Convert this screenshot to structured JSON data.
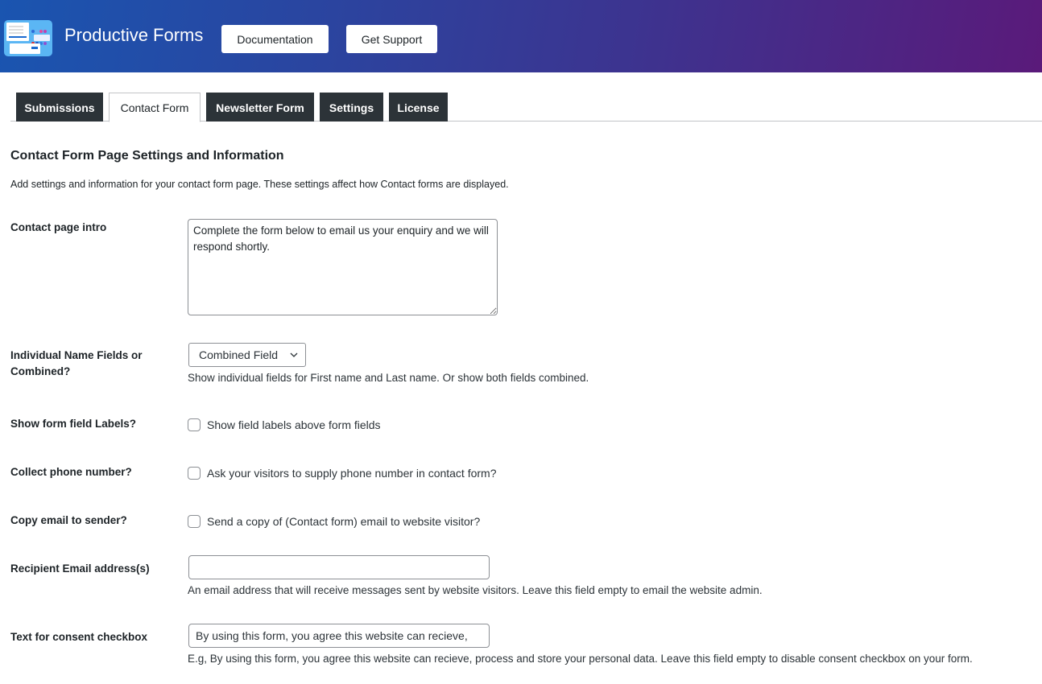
{
  "header": {
    "app_title": "Productive Forms",
    "buttons": {
      "documentation": "Documentation",
      "support": "Get Support"
    },
    "logo_icon": "productive-forms-logo"
  },
  "tabs": [
    {
      "label": "Submissions",
      "active": false
    },
    {
      "label": "Contact Form",
      "active": true
    },
    {
      "label": "Newsletter Form",
      "active": false
    },
    {
      "label": "Settings",
      "active": false
    },
    {
      "label": "License",
      "active": false
    }
  ],
  "page": {
    "title": "Contact Form Page Settings and Information",
    "intro": "Add settings and information for your contact form page. These settings affect how Contact forms are displayed."
  },
  "fields": {
    "contact_intro": {
      "label": "Contact page intro",
      "value": "Complete the form below to email us your enquiry and we will respond shortly."
    },
    "name_fields": {
      "label": "Individual Name Fields or Combined?",
      "selected": "Combined Field",
      "description": "Show individual fields for First name and Last name. Or show both fields combined."
    },
    "show_labels": {
      "label": "Show form field Labels?",
      "checkbox_text": "Show field labels above form fields",
      "checked": false
    },
    "collect_phone": {
      "label": "Collect phone number?",
      "checkbox_text": "Ask your visitors to supply phone number in contact form?",
      "checked": false
    },
    "copy_email": {
      "label": "Copy email to sender?",
      "checkbox_text": "Send a copy of (Contact form) email to website visitor?",
      "checked": false
    },
    "recipient_email": {
      "label": "Recipient Email address(s)",
      "value": "",
      "description": "An email address that will receive messages sent by website visitors. Leave this field empty to email the website admin."
    },
    "consent_text": {
      "label": "Text for consent checkbox",
      "value": "By using this form, you agree this website can recieve,",
      "description": "E.g, By using this form, you agree this website can recieve, process and store your personal data. Leave this field empty to disable consent checkbox on your form."
    }
  },
  "colors": {
    "tab_dark": "#2c3338",
    "header_start": "#1a55b0",
    "header_end": "#5a1a7a"
  }
}
